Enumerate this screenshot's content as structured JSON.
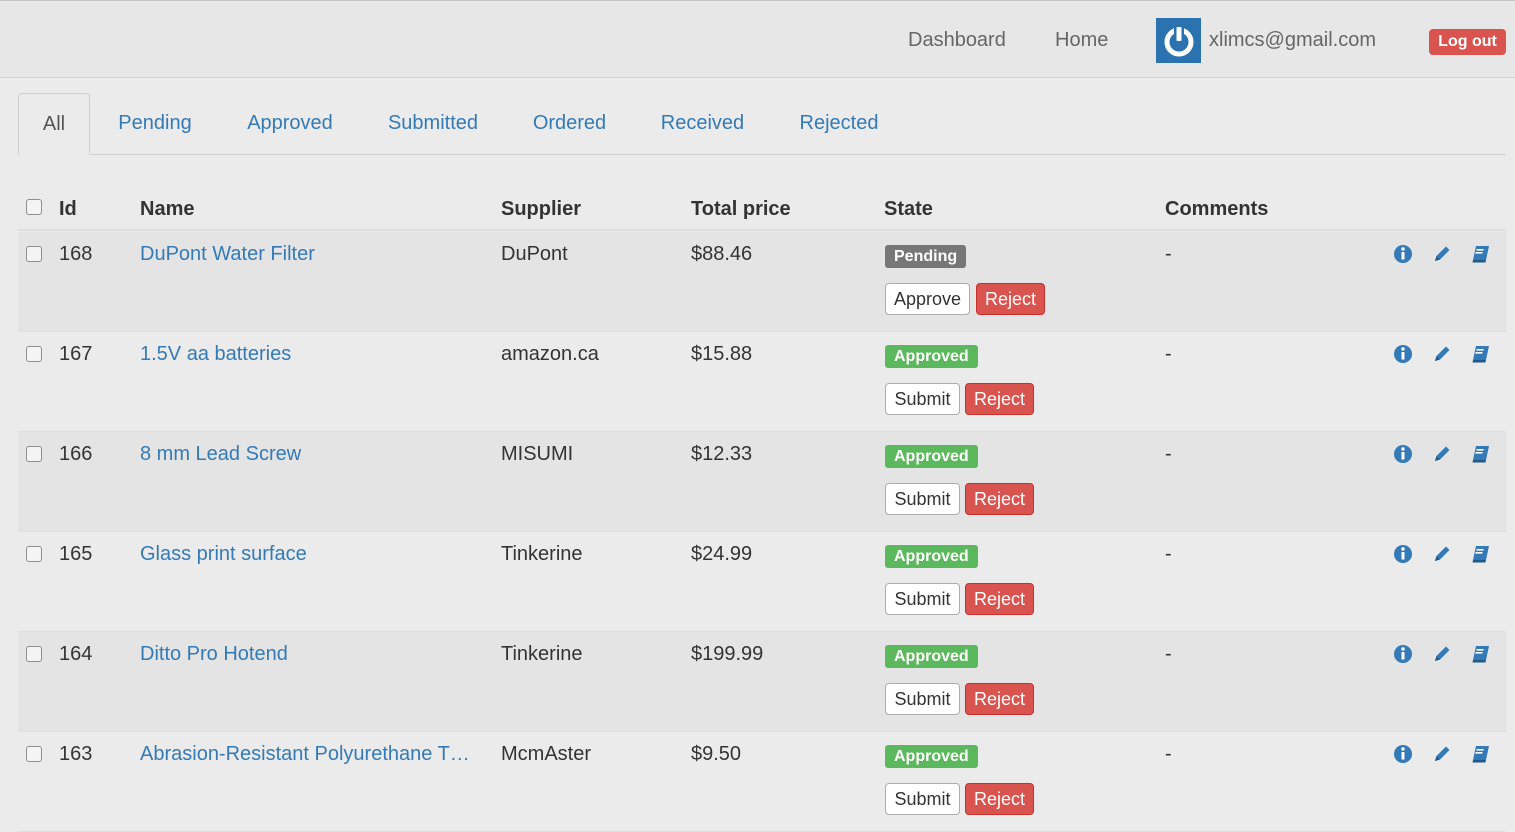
{
  "navbar": {
    "links": [
      "Dashboard",
      "Home"
    ],
    "user_email": "xlimcs@gmail.com",
    "logout_label": "Log out",
    "avatar_icon": "power-icon"
  },
  "tabs": [
    "All",
    "Pending",
    "Approved",
    "Submitted",
    "Ordered",
    "Received",
    "Rejected"
  ],
  "active_tab": "All",
  "table": {
    "columns": [
      "Id",
      "Name",
      "Supplier",
      "Total price",
      "State",
      "Comments"
    ],
    "rows": [
      {
        "id": "168",
        "name": "DuPont Water Filter",
        "supplier": "DuPont",
        "total": "$88.46",
        "state": "Pending",
        "comments": "-",
        "actions": [
          "Approve",
          "Reject"
        ]
      },
      {
        "id": "167",
        "name": "1.5V aa batteries",
        "supplier": "amazon.ca",
        "total": "$15.88",
        "state": "Approved",
        "comments": "-",
        "actions": [
          "Submit",
          "Reject"
        ]
      },
      {
        "id": "166",
        "name": "8 mm Lead Screw",
        "supplier": "MISUMI",
        "total": "$12.33",
        "state": "Approved",
        "comments": "-",
        "actions": [
          "Submit",
          "Reject"
        ]
      },
      {
        "id": "165",
        "name": "Glass print surface",
        "supplier": "Tinkerine",
        "total": "$24.99",
        "state": "Approved",
        "comments": "-",
        "actions": [
          "Submit",
          "Reject"
        ]
      },
      {
        "id": "164",
        "name": "Ditto Pro Hotend",
        "supplier": "Tinkerine",
        "total": "$199.99",
        "state": "Approved",
        "comments": "-",
        "actions": [
          "Submit",
          "Reject"
        ]
      },
      {
        "id": "163",
        "name": "Abrasion-Resistant Polyurethane T…",
        "supplier": "McmAster",
        "total": "$9.50",
        "state": "Approved",
        "comments": "-",
        "actions": [
          "Submit",
          "Reject"
        ]
      }
    ],
    "row_icons": [
      "info-icon",
      "pencil-icon",
      "book-icon"
    ]
  },
  "colors": {
    "link": "#337ab7",
    "danger": "#d9534f",
    "success": "#5cb85c",
    "pending": "#777777",
    "nav_avatar": "#2a73b0"
  }
}
